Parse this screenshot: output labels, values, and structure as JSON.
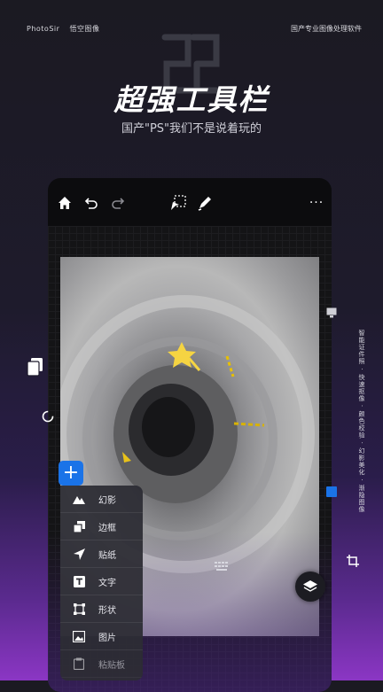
{
  "header": {
    "brand_name": "PhotoSir",
    "brand_sub": "悟空图像",
    "tagline": "国产专业图像处理软件",
    "headline": "超强工具栏",
    "subline": "国产\"PS\"我们不是说着玩的"
  },
  "toolbar": {
    "icons": [
      "home-icon",
      "undo-icon",
      "redo-icon",
      "selection-icon",
      "brush-icon",
      "more-icon"
    ],
    "more_label": "···"
  },
  "add_button": {
    "label": "+"
  },
  "tool_menu": {
    "items": [
      {
        "icon": "mountain-icon",
        "label": "幻影"
      },
      {
        "icon": "frame-icon",
        "label": "边框"
      },
      {
        "icon": "sticker-arrow-icon",
        "label": "贴纸"
      },
      {
        "icon": "text-icon",
        "label": "文字"
      },
      {
        "icon": "shape-icon",
        "label": "形状"
      },
      {
        "icon": "image-icon",
        "label": "图片"
      },
      {
        "icon": "clipboard-icon",
        "label": "粘贴板"
      }
    ]
  },
  "side_caption": "智能证件照 · 快速抠像 · 颜色校验 · 幻影美化 · 渐隐图像",
  "colors": {
    "accent": "#1a73e8",
    "star": "#f5d442"
  }
}
